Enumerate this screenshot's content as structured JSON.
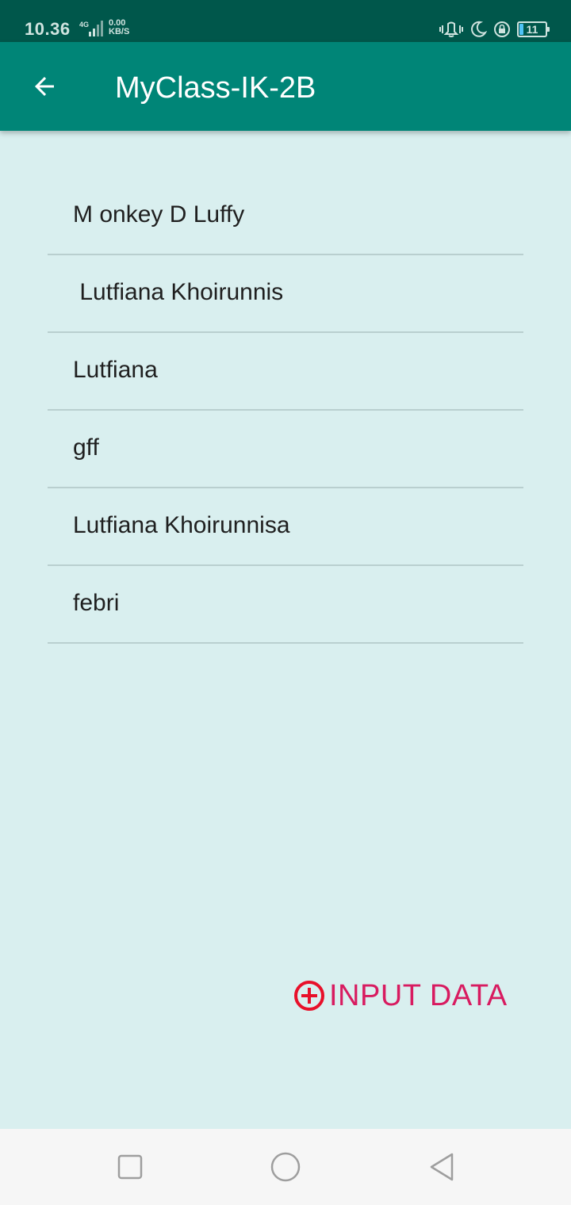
{
  "status_bar": {
    "time": "10.36",
    "network": "4G",
    "speed_value": "0.00",
    "speed_unit": "KB/S",
    "battery": "11"
  },
  "app_bar": {
    "back_icon": "arrow-back-icon",
    "title": "MyClass-IK-2B"
  },
  "list": {
    "items": [
      {
        "label": "M onkey D Luffy"
      },
      {
        "label": " Lutfiana Khoirunnis"
      },
      {
        "label": "Lutfiana"
      },
      {
        "label": "gff"
      },
      {
        "label": "Lutfiana Khoirunnisa"
      },
      {
        "label": "febri"
      }
    ]
  },
  "input_button": {
    "icon": "plus-circle-icon",
    "label": "INPUT DATA"
  },
  "colors": {
    "status_bar": "#00574b",
    "app_bar": "#008577",
    "background": "#d9efef",
    "accent": "#d81b60",
    "plus_icon": "#e8102a"
  },
  "nav_bar": {
    "recent": "square-icon",
    "home": "circle-icon",
    "back": "triangle-back-icon"
  }
}
